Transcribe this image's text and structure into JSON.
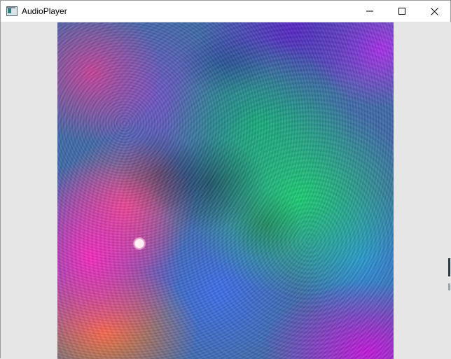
{
  "window": {
    "title": "AudioPlayer",
    "icon": "app-window-icon",
    "controls": {
      "minimize_icon": "minimize-icon",
      "maximize_icon": "maximize-icon",
      "close_icon": "close-icon"
    }
  },
  "visualizer": {
    "description_icon": "visualizer-canvas"
  }
}
